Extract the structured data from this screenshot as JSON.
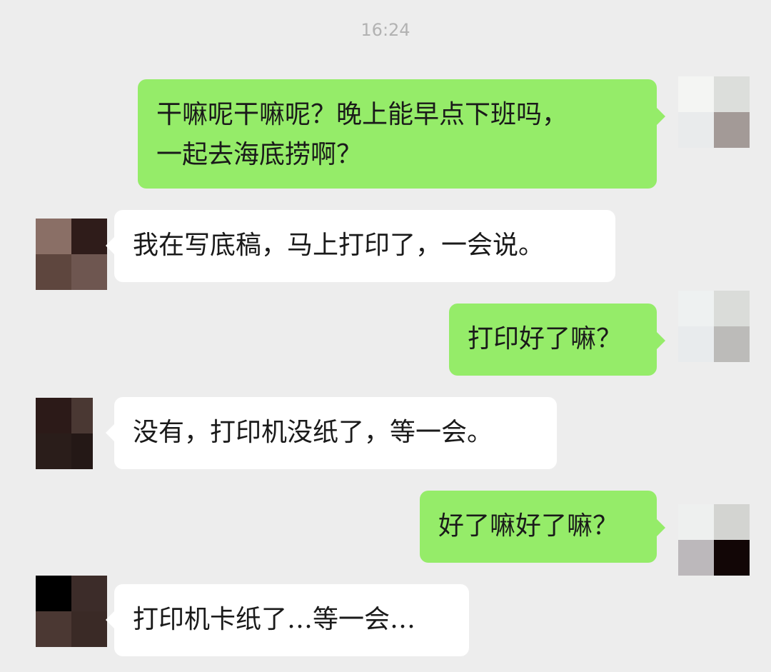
{
  "chat": {
    "timestamp": "16:24",
    "messages": [
      {
        "sender": "me",
        "lines": [
          "干嘛呢干嘛呢？晚上能早点下班吗，",
          "一起去海底捞啊？"
        ]
      },
      {
        "sender": "them",
        "lines": [
          "我在写底稿，马上打印了，一会说。"
        ]
      },
      {
        "sender": "me",
        "lines": [
          "打印好了嘛？"
        ]
      },
      {
        "sender": "them",
        "lines": [
          "没有，打印机没纸了，等一会。"
        ]
      },
      {
        "sender": "me",
        "lines": [
          "好了嘛好了嘛？"
        ]
      },
      {
        "sender": "them",
        "lines": [
          "打印机卡纸了…等一会…"
        ]
      }
    ]
  },
  "colors": {
    "background": "#ededed",
    "my_bubble": "#95ec69",
    "their_bubble": "#ffffff",
    "timestamp_text": "#b2b2b2"
  }
}
